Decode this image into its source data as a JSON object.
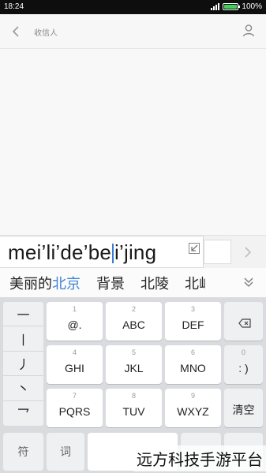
{
  "status_bar": {
    "time": "18:24",
    "battery_text": "100%",
    "battery_level": 1.0
  },
  "header": {
    "recipient_label": "收信人",
    "icons": [
      "back-icon",
      "person-icon"
    ]
  },
  "composition": {
    "pinyin_before_caret": "mei’li’de’be",
    "pinyin_after_caret": "i’jing"
  },
  "candidates": {
    "first": {
      "plain": "美丽的",
      "highlighted": "北京"
    },
    "others": [
      "背景",
      "北陵",
      "北屾"
    ]
  },
  "keyboard": {
    "symbol_column": [
      "一",
      "丨",
      "丿",
      "丶",
      "乛"
    ],
    "keys": [
      {
        "num": "1",
        "label": "@."
      },
      {
        "num": "2",
        "label": "ABC"
      },
      {
        "num": "3",
        "label": "DEF"
      },
      {
        "num": "4",
        "label": "GHI"
      },
      {
        "num": "5",
        "label": "JKL"
      },
      {
        "num": "6",
        "label": "MNO"
      },
      {
        "num": "7",
        "label": "PQRS"
      },
      {
        "num": "8",
        "label": "TUV"
      },
      {
        "num": "9",
        "label": "WXYZ"
      }
    ],
    "right_keys": {
      "zero_num": "0",
      "zero_label": ": )",
      "clear_label": "清空"
    },
    "bottom_row": {
      "symbols": "符",
      "words": "词",
      "space": "",
      "extra": "",
      "next": ""
    }
  },
  "watermark": "远方科技手游平台",
  "colors": {
    "accent": "#3f83d6",
    "battery_green": "#3fd159",
    "keyboard_bg": "#d9dbde"
  }
}
